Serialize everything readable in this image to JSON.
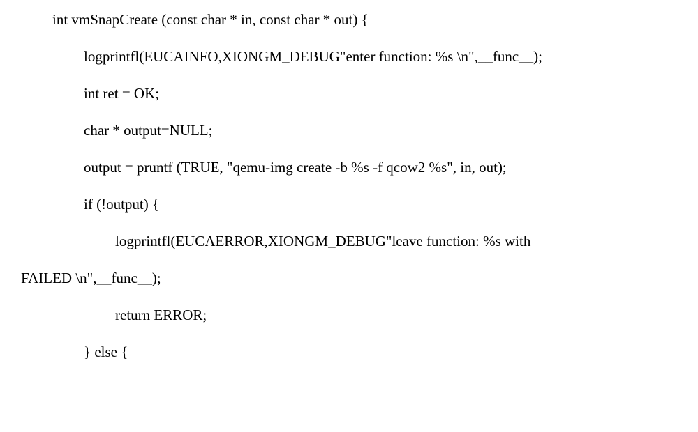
{
  "code": {
    "line1": "int vmSnapCreate (const char * in, const char * out) {",
    "line2": "logprintfl(EUCAINFO,XIONGM_DEBUG\"enter function: %s \\n\",__func__);",
    "line3": "int ret = OK;",
    "line4": "char * output=NULL;",
    "line5": "output = pruntf (TRUE, \"qemu-img create -b %s -f qcow2 %s\", in, out);",
    "line6": "if (!output) {",
    "line7": "logprintfl(EUCAERROR,XIONGM_DEBUG\"leave function: %s with",
    "line8": "FAILED \\n\",__func__);",
    "line9": "return ERROR;",
    "line10": "} else {"
  }
}
